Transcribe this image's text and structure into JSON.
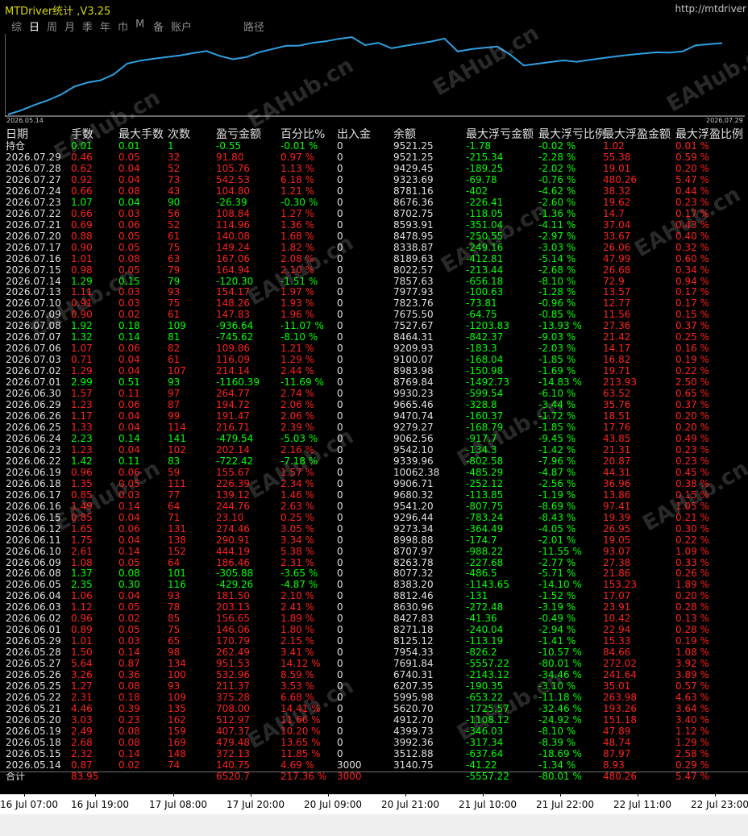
{
  "window": {
    "title": "MTDriver统计 ,V3.25",
    "url": "http://mtdriver"
  },
  "tabs": [
    "综",
    "日",
    "周",
    "月",
    "季",
    "年",
    "巾",
    "M",
    "备",
    "账户",
    "路径"
  ],
  "active_tab": 1,
  "chart": {
    "start_label": "2026.05.14",
    "end_label": "2026.07.29",
    "line_color": "#2ea0e0"
  },
  "chart_data": {
    "type": "line",
    "x": [
      "2026.05.14",
      "2026.05.15",
      "2026.05.18",
      "2026.05.19",
      "2026.05.20",
      "2026.05.21",
      "2026.05.22",
      "2026.05.25",
      "2026.05.26",
      "2026.05.27",
      "2026.05.28",
      "2026.05.29",
      "2026.06.01",
      "2026.06.02",
      "2026.06.03",
      "2026.06.04",
      "2026.06.05",
      "2026.06.08",
      "2026.06.09",
      "2026.06.10",
      "2026.06.11",
      "2026.06.12",
      "2026.06.15",
      "2026.06.16",
      "2026.06.17",
      "2026.06.18",
      "2026.06.19",
      "2026.06.22",
      "2026.06.23",
      "2026.06.24",
      "2026.06.25",
      "2026.06.26",
      "2026.06.29",
      "2026.06.30",
      "2026.07.01",
      "2026.07.02",
      "2026.07.03",
      "2026.07.06",
      "2026.07.07",
      "2026.07.08",
      "2026.07.09",
      "2026.07.10",
      "2026.07.13",
      "2026.07.14",
      "2026.07.15",
      "2026.07.16",
      "2026.07.17",
      "2026.07.20",
      "2026.07.21",
      "2026.07.22",
      "2026.07.23",
      "2026.07.24",
      "2026.07.27",
      "2026.07.28",
      "2026.07.29"
    ],
    "values": [
      3140.75,
      3512.88,
      3992.36,
      4399.73,
      4912.7,
      5620.7,
      5995.98,
      6207.35,
      6740.31,
      7691.84,
      7954.33,
      8125.12,
      8271.18,
      8427.83,
      8630.96,
      8812.46,
      8383.2,
      8077.32,
      8263.78,
      8707.97,
      8998.88,
      9273.34,
      9296.44,
      9541.2,
      9680.32,
      9906.71,
      10062.38,
      9339.96,
      9542.1,
      9062.56,
      9279.27,
      9470.74,
      9665.46,
      9930.23,
      8769.84,
      8983.98,
      9100.07,
      9209.93,
      8464.31,
      7527.67,
      7675.5,
      7823.76,
      7977.93,
      7857.63,
      8022.57,
      8189.63,
      8338.87,
      8478.95,
      8593.91,
      8702.75,
      8676.36,
      8781.16,
      9323.69,
      9429.45,
      9521.25
    ],
    "series_label": "余额"
  },
  "table": {
    "headers": [
      "日期",
      "手数",
      "最大手数",
      "次数",
      "盈亏金额",
      "百分比%",
      "出入金",
      "余额",
      "最大浮亏金额",
      "最大浮亏比例",
      "最大浮盈金额",
      "最大浮盈比例"
    ],
    "rows": [
      [
        "持仓",
        "0.01",
        "0.01",
        "1",
        "-0.55",
        "-0.01 %",
        "0",
        "9521.25",
        "-1.78",
        "-0.02 %",
        "1.02",
        "0.01 %"
      ],
      [
        "2026.07.29",
        "0.46",
        "0.05",
        "32",
        "91.80",
        "0.97 %",
        "0",
        "9521.25",
        "-215.34",
        "-2.28 %",
        "55.38",
        "0.59 %"
      ],
      [
        "2026.07.28",
        "0.62",
        "0.04",
        "52",
        "105.76",
        "1.13 %",
        "0",
        "9429.45",
        "-189.25",
        "-2.02 %",
        "19.01",
        "0.20 %"
      ],
      [
        "2026.07.27",
        "0.92",
        "0.04",
        "73",
        "542.53",
        "6.18 %",
        "0",
        "9323.69",
        "-69.78",
        "-0.76 %",
        "480.26",
        "5.47 %"
      ],
      [
        "2026.07.24",
        "0.66",
        "0.08",
        "43",
        "104.80",
        "1.21 %",
        "0",
        "8781.16",
        "-402",
        "-4.62 %",
        "38.32",
        "0.44 %"
      ],
      [
        "2026.07.23",
        "1.07",
        "0.04",
        "90",
        "-26.39",
        "-0.30 %",
        "0",
        "8676.36",
        "-226.41",
        "-2.60 %",
        "19.62",
        "0.23 %"
      ],
      [
        "2026.07.22",
        "0.66",
        "0.03",
        "56",
        "108.84",
        "1.27 %",
        "0",
        "8702.75",
        "-118.05",
        "-1.36 %",
        "14.7",
        "0.17 %"
      ],
      [
        "2026.07.21",
        "0.69",
        "0.06",
        "52",
        "114.96",
        "1.36 %",
        "0",
        "8593.91",
        "-351.04",
        "-4.11 %",
        "37.04",
        "0.43 %"
      ],
      [
        "2026.07.20",
        "0.88",
        "0.05",
        "61",
        "140.08",
        "1.68 %",
        "0",
        "8478.95",
        "-250.55",
        "-2.97 %",
        "33.67",
        "0.40 %"
      ],
      [
        "2026.07.17",
        "0.90",
        "0.05",
        "75",
        "149.24",
        "1.82 %",
        "0",
        "8338.87",
        "-249.16",
        "-3.03 %",
        "26.06",
        "0.32 %"
      ],
      [
        "2026.07.16",
        "1.01",
        "0.08",
        "63",
        "167.06",
        "2.08 %",
        "0",
        "8189.63",
        "-412.81",
        "-5.14 %",
        "47.99",
        "0.60 %"
      ],
      [
        "2026.07.15",
        "0.98",
        "0.05",
        "79",
        "164.94",
        "2.10 %",
        "0",
        "8022.57",
        "-213.44",
        "-2.68 %",
        "26.68",
        "0.34 %"
      ],
      [
        "2026.07.14",
        "1.29",
        "0.15",
        "79",
        "-120.30",
        "-1.51 %",
        "0",
        "7857.63",
        "-656.18",
        "-8.10 %",
        "72.9",
        "0.94 %"
      ],
      [
        "2026.07.13",
        "1.11",
        "0.03",
        "93",
        "154.17",
        "1.97 %",
        "0",
        "7977.93",
        "-100.63",
        "-1.28 %",
        "13.57",
        "0.17 %"
      ],
      [
        "2026.07.10",
        "0.91",
        "0.03",
        "75",
        "148.26",
        "1.93 %",
        "0",
        "7823.76",
        "-73.81",
        "-0.96 %",
        "12.77",
        "0.17 %"
      ],
      [
        "2026.07.09",
        "0.90",
        "0.02",
        "61",
        "147.83",
        "1.96 %",
        "0",
        "7675.50",
        "-64.75",
        "-0.85 %",
        "11.56",
        "0.15 %"
      ],
      [
        "2026.07.08",
        "1.92",
        "0.18",
        "109",
        "-936.64",
        "-11.07 %",
        "0",
        "7527.67",
        "-1203.83",
        "-13.93 %",
        "27.36",
        "0.37 %"
      ],
      [
        "2026.07.07",
        "1.32",
        "0.14",
        "81",
        "-745.62",
        "-8.10 %",
        "0",
        "8464.31",
        "-842.37",
        "-9.03 %",
        "21.42",
        "0.25 %"
      ],
      [
        "2026.07.06",
        "1.07",
        "0.06",
        "82",
        "109.86",
        "1.21 %",
        "0",
        "9209.93",
        "-183.3",
        "-2.03 %",
        "14.17",
        "0.16 %"
      ],
      [
        "2026.07.03",
        "0.71",
        "0.04",
        "61",
        "116.09",
        "1.29 %",
        "0",
        "9100.07",
        "-168.04",
        "-1.85 %",
        "16.82",
        "0.19 %"
      ],
      [
        "2026.07.02",
        "1.29",
        "0.04",
        "107",
        "214.14",
        "2.44 %",
        "0",
        "8983.98",
        "-150.98",
        "-1.69 %",
        "19.71",
        "0.22 %"
      ],
      [
        "2026.07.01",
        "2.99",
        "0.51",
        "93",
        "-1160.39",
        "-11.69 %",
        "0",
        "8769.84",
        "-1492.73",
        "-14.83 %",
        "213.93",
        "2.50 %"
      ],
      [
        "2026.06.30",
        "1.57",
        "0.11",
        "97",
        "264.77",
        "2.74 %",
        "0",
        "9930.23",
        "-599.54",
        "-6.10 %",
        "63.52",
        "0.65 %"
      ],
      [
        "2026.06.29",
        "1.23",
        "0.06",
        "87",
        "194.72",
        "2.06 %",
        "0",
        "9665.46",
        "-328.8",
        "-3.44 %",
        "35.76",
        "0.37 %"
      ],
      [
        "2026.06.26",
        "1.17",
        "0.04",
        "99",
        "191.47",
        "2.06 %",
        "0",
        "9470.74",
        "-160.37",
        "-1.72 %",
        "18.51",
        "0.20 %"
      ],
      [
        "2026.06.25",
        "1.33",
        "0.04",
        "114",
        "216.71",
        "2.39 %",
        "0",
        "9279.27",
        "-168.79",
        "-1.85 %",
        "17.76",
        "0.20 %"
      ],
      [
        "2026.06.24",
        "2.23",
        "0.14",
        "141",
        "-479.54",
        "-5.03 %",
        "0",
        "9062.56",
        "-917.7",
        "-9.45 %",
        "43.85",
        "0.49 %"
      ],
      [
        "2026.06.23",
        "1.23",
        "0.04",
        "102",
        "202.14",
        "2.16 %",
        "0",
        "9542.10",
        "-134.3",
        "-1.42 %",
        "21.31",
        "0.23 %"
      ],
      [
        "2026.06.22",
        "1.42",
        "0.11",
        "83",
        "-722.42",
        "-7.18 %",
        "0",
        "9339.96",
        "-802.58",
        "-7.96 %",
        "20.87",
        "0.23 %"
      ],
      [
        "2026.06.19",
        "0.96",
        "0.06",
        "59",
        "155.67",
        "1.57 %",
        "0",
        "10062.38",
        "-485.29",
        "-4.87 %",
        "44.31",
        "0.45 %"
      ],
      [
        "2026.06.18",
        "1.35",
        "0.05",
        "111",
        "226.39",
        "2.34 %",
        "0",
        "9906.71",
        "-252.12",
        "-2.56 %",
        "36.96",
        "0.38 %"
      ],
      [
        "2026.06.17",
        "0.85",
        "0.03",
        "77",
        "139.12",
        "1.46 %",
        "0",
        "9680.32",
        "-113.85",
        "-1.19 %",
        "13.86",
        "0.15 %"
      ],
      [
        "2026.06.16",
        "1.49",
        "0.14",
        "64",
        "244.76",
        "2.63 %",
        "0",
        "9541.20",
        "-807.75",
        "-8.69 %",
        "97.41",
        "1.05 %"
      ],
      [
        "2026.06.15",
        "0.85",
        "0.04",
        "71",
        "23.10",
        "0.25 %",
        "0",
        "9296.44",
        "-783.24",
        "-8.43 %",
        "19.39",
        "0.21 %"
      ],
      [
        "2026.06.12",
        "1.65",
        "0.06",
        "131",
        "274.46",
        "3.05 %",
        "0",
        "9273.34",
        "-364.49",
        "-4.05 %",
        "26.95",
        "0.30 %"
      ],
      [
        "2026.06.11",
        "1.75",
        "0.04",
        "138",
        "290.91",
        "3.34 %",
        "0",
        "8998.88",
        "-174.7",
        "-2.01 %",
        "19.05",
        "0.22 %"
      ],
      [
        "2026.06.10",
        "2.61",
        "0.14",
        "152",
        "444.19",
        "5.38 %",
        "0",
        "8707.97",
        "-988.22",
        "-11.55 %",
        "93.07",
        "1.09 %"
      ],
      [
        "2026.06.09",
        "1.08",
        "0.05",
        "64",
        "186.46",
        "2.31 %",
        "0",
        "8263.78",
        "-227.68",
        "-2.77 %",
        "27.38",
        "0.33 %"
      ],
      [
        "2026.06.08",
        "1.37",
        "0.08",
        "101",
        "-305.88",
        "-3.65 %",
        "0",
        "8077.32",
        "-486.5",
        "-5.71 %",
        "21.86",
        "0.26 %"
      ],
      [
        "2026.06.05",
        "2.35",
        "0.30",
        "116",
        "-429.26",
        "-4.87 %",
        "0",
        "8383.20",
        "-1143.65",
        "-14.10 %",
        "153.23",
        "1.89 %"
      ],
      [
        "2026.06.04",
        "1.06",
        "0.04",
        "93",
        "181.50",
        "2.10 %",
        "0",
        "8812.46",
        "-131",
        "-1.52 %",
        "17.07",
        "0.20 %"
      ],
      [
        "2026.06.03",
        "1.12",
        "0.05",
        "78",
        "203.13",
        "2.41 %",
        "0",
        "8630.96",
        "-272.48",
        "-3.19 %",
        "23.91",
        "0.28 %"
      ],
      [
        "2026.06.02",
        "0.96",
        "0.02",
        "85",
        "156.65",
        "1.89 %",
        "0",
        "8427.83",
        "-41.36",
        "-0.49 %",
        "10.42",
        "0.13 %"
      ],
      [
        "2026.06.01",
        "0.89",
        "0.05",
        "75",
        "146.06",
        "1.80 %",
        "0",
        "8271.18",
        "-240.04",
        "-2.94 %",
        "22.94",
        "0.28 %"
      ],
      [
        "2026.05.29",
        "1.01",
        "0.03",
        "65",
        "170.79",
        "2.15 %",
        "0",
        "8125.12",
        "-113.19",
        "-1.41 %",
        "15.33",
        "0.19 %"
      ],
      [
        "2026.05.28",
        "1.50",
        "0.14",
        "98",
        "262.49",
        "3.41 %",
        "0",
        "7954.33",
        "-826.2",
        "-10.57 %",
        "84.66",
        "1.08 %"
      ],
      [
        "2026.05.27",
        "5.64",
        "0.87",
        "134",
        "951.53",
        "14.12 %",
        "0",
        "7691.84",
        "-5557.22",
        "-80.01 %",
        "272.02",
        "3.92 %"
      ],
      [
        "2026.05.26",
        "3.26",
        "0.36",
        "100",
        "532.96",
        "8.59 %",
        "0",
        "6740.31",
        "-2143.12",
        "-34.46 %",
        "241.64",
        "3.89 %"
      ],
      [
        "2026.05.25",
        "1.27",
        "0.08",
        "93",
        "211.37",
        "3.53 %",
        "0",
        "6207.35",
        "-190.35",
        "-3.10 %",
        "35.01",
        "0.57 %"
      ],
      [
        "2026.05.22",
        "2.31",
        "0.18",
        "109",
        "375.28",
        "6.68 %",
        "0",
        "5995.98",
        "-653.22",
        "-11.18 %",
        "263.98",
        "4.63 %"
      ],
      [
        "2026.05.21",
        "4.46",
        "0.39",
        "135",
        "708.00",
        "14.41 %",
        "0",
        "5620.70",
        "-1725.57",
        "-32.46 %",
        "193.26",
        "3.64 %"
      ],
      [
        "2026.05.20",
        "3.03",
        "0.23",
        "162",
        "512.97",
        "11.66 %",
        "0",
        "4912.70",
        "-1108.12",
        "-24.92 %",
        "151.18",
        "3.40 %"
      ],
      [
        "2026.05.19",
        "2.49",
        "0.08",
        "159",
        "407.37",
        "10.20 %",
        "0",
        "4399.73",
        "-346.03",
        "-8.10 %",
        "47.89",
        "1.12 %"
      ],
      [
        "2026.05.18",
        "2.68",
        "0.08",
        "169",
        "479.48",
        "13.65 %",
        "0",
        "3992.36",
        "-317.34",
        "-8.39 %",
        "48.74",
        "1.29 %"
      ],
      [
        "2026.05.15",
        "2.32",
        "0.14",
        "148",
        "372.13",
        "11.85 %",
        "0",
        "3512.88",
        "-637.64",
        "-18.69 %",
        "87.97",
        "2.58 %"
      ],
      [
        "2026.05.14",
        "0.87",
        "0.02",
        "74",
        "140.75",
        "4.69 %",
        "3000",
        "3140.75",
        "-41.22",
        "-1.34 %",
        "8.93",
        "0.29 %"
      ],
      [
        "合计",
        "83.95",
        "",
        "",
        "6520.7",
        "217.36 %",
        "3000",
        "",
        "-5557.22",
        "-80.01 %",
        "480.26",
        "5.47 %"
      ]
    ]
  },
  "watermarks": [
    "EAHub.cn",
    "EAHub.cn",
    "EAHub.cn",
    "EAHub.cn",
    "EAHub.cn",
    "EAHub.cn",
    "EAHub.cn",
    "EAHub.cn",
    "EAHub.cn",
    "EAHub.cn",
    "EAHub.cn",
    "EAHub.cn",
    "EAHub.cn",
    "EAHub.cn"
  ],
  "time_axis": [
    "16 Jul 07:00",
    "16 Jul 19:00",
    "17 Jul 08:00",
    "17 Jul 20:00",
    "20 Jul 09:00",
    "20 Jul 21:00",
    "21 Jul 10:00",
    "21 Jul 22:00",
    "22 Jul 11:00",
    "22 Jul 23:00"
  ],
  "colors": {
    "positive": "#00ff00",
    "negative": "#ff2020",
    "neutral": "#e0e0e0",
    "title": "#d8d800",
    "bg": "#000000"
  }
}
